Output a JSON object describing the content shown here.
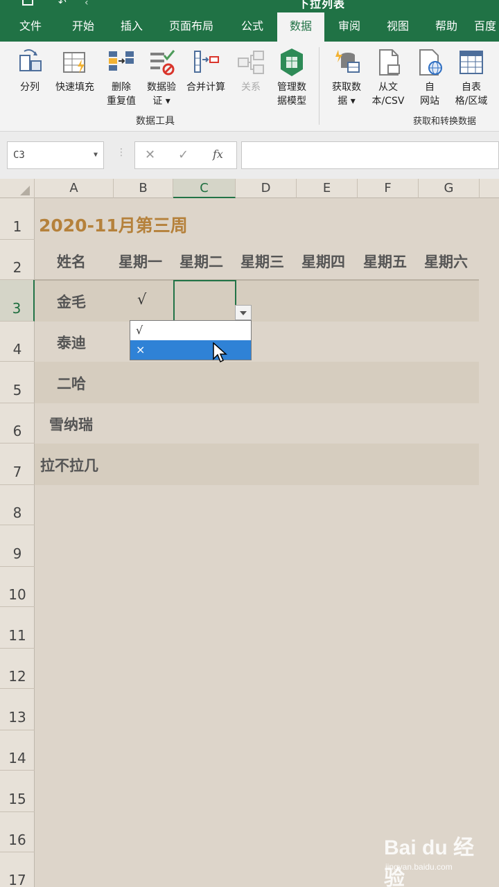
{
  "app": {
    "doc_title": "下拉列表"
  },
  "tabs": [
    {
      "label": "文件"
    },
    {
      "label": "开始"
    },
    {
      "label": "插入"
    },
    {
      "label": "页面布局"
    },
    {
      "label": "公式"
    },
    {
      "label": "数据"
    },
    {
      "label": "审阅"
    },
    {
      "label": "视图"
    },
    {
      "label": "帮助"
    },
    {
      "label": "百度"
    }
  ],
  "active_tab": "数据",
  "ribbon": {
    "data_tools": {
      "label": "数据工具",
      "buttons": [
        {
          "line1": "分列",
          "line2": ""
        },
        {
          "line1": "快速填充",
          "line2": ""
        },
        {
          "line1": "删除",
          "line2": "重复值"
        },
        {
          "line1": "数据验",
          "line2": "证 ▾"
        },
        {
          "line1": "合并计算",
          "line2": ""
        },
        {
          "line1": "关系",
          "line2": ""
        },
        {
          "line1": "管理数",
          "line2": "据模型"
        }
      ]
    },
    "get_transform": {
      "label": "获取和转换数据",
      "buttons": [
        {
          "line1": "获取数",
          "line2": "据 ▾"
        },
        {
          "line1": "从文",
          "line2": "本/CSV"
        },
        {
          "line1": "自",
          "line2": "网站"
        },
        {
          "line1": "自表",
          "line2": "格/区域"
        }
      ]
    }
  },
  "formula_bar": {
    "name_box": "C3",
    "cancel": "✕",
    "enter": "✓",
    "fx": "fx",
    "value": ""
  },
  "columns": [
    "A",
    "B",
    "C",
    "D",
    "E",
    "F",
    "G"
  ],
  "rows": [
    "1",
    "2",
    "3",
    "4",
    "5",
    "6",
    "7",
    "8",
    "9",
    "10",
    "11",
    "12",
    "13",
    "14",
    "15",
    "16",
    "17"
  ],
  "sheet": {
    "title": "2020-11月第三周",
    "header": [
      "姓名",
      "星期一",
      "星期二",
      "星期三",
      "星期四",
      "星期五",
      "星期六"
    ],
    "names": [
      "金毛",
      "泰迪",
      "二哈",
      "雪纳瑞",
      "拉不拉几"
    ],
    "b3": "√"
  },
  "dropdown": {
    "options": [
      "√",
      "×"
    ],
    "highlighted": 1
  },
  "watermark": {
    "logo": "Bai du 经验",
    "sub": "jingyan.baidu.com"
  }
}
